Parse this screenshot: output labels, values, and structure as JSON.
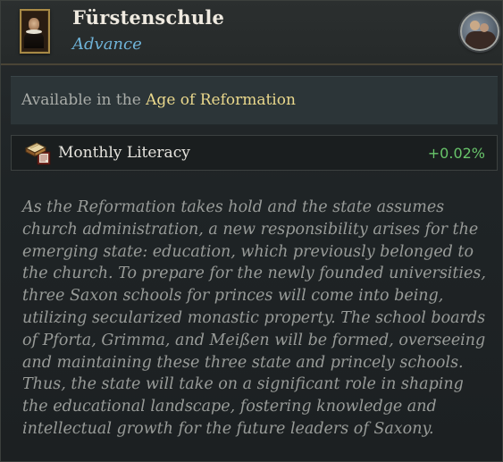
{
  "header": {
    "title": "Fürstenschule",
    "subtitle": "Advance",
    "portrait_icon": "scholar-portrait-icon",
    "round_icon": "reformation-age-emblem-icon"
  },
  "availability": {
    "prefix": "Available in the ",
    "age": "Age of Reformation"
  },
  "effect": {
    "icon": "literacy-books-icon",
    "label": "Monthly Literacy",
    "value": "+0.02%"
  },
  "description": "As the Reformation takes hold and the state assumes church administration, a new responsibility arises for the emerging state: education, which previously belonged to the church. To prepare for the newly founded universities, three Saxon schools for princes will come into being, utilizing secularized monastic property. The school boards of Pforta, Grimma, and Meißen will be formed, overseeing and maintaining these three state and princely schools. Thus, the state will take on a significant role in shaping the educational landscape, fostering knowledge and intellectual growth for the future leaders of Saxony.",
  "colors": {
    "subtitle": "#6fb3d8",
    "age_highlight": "#ead88c",
    "positive_value": "#68c46a"
  }
}
